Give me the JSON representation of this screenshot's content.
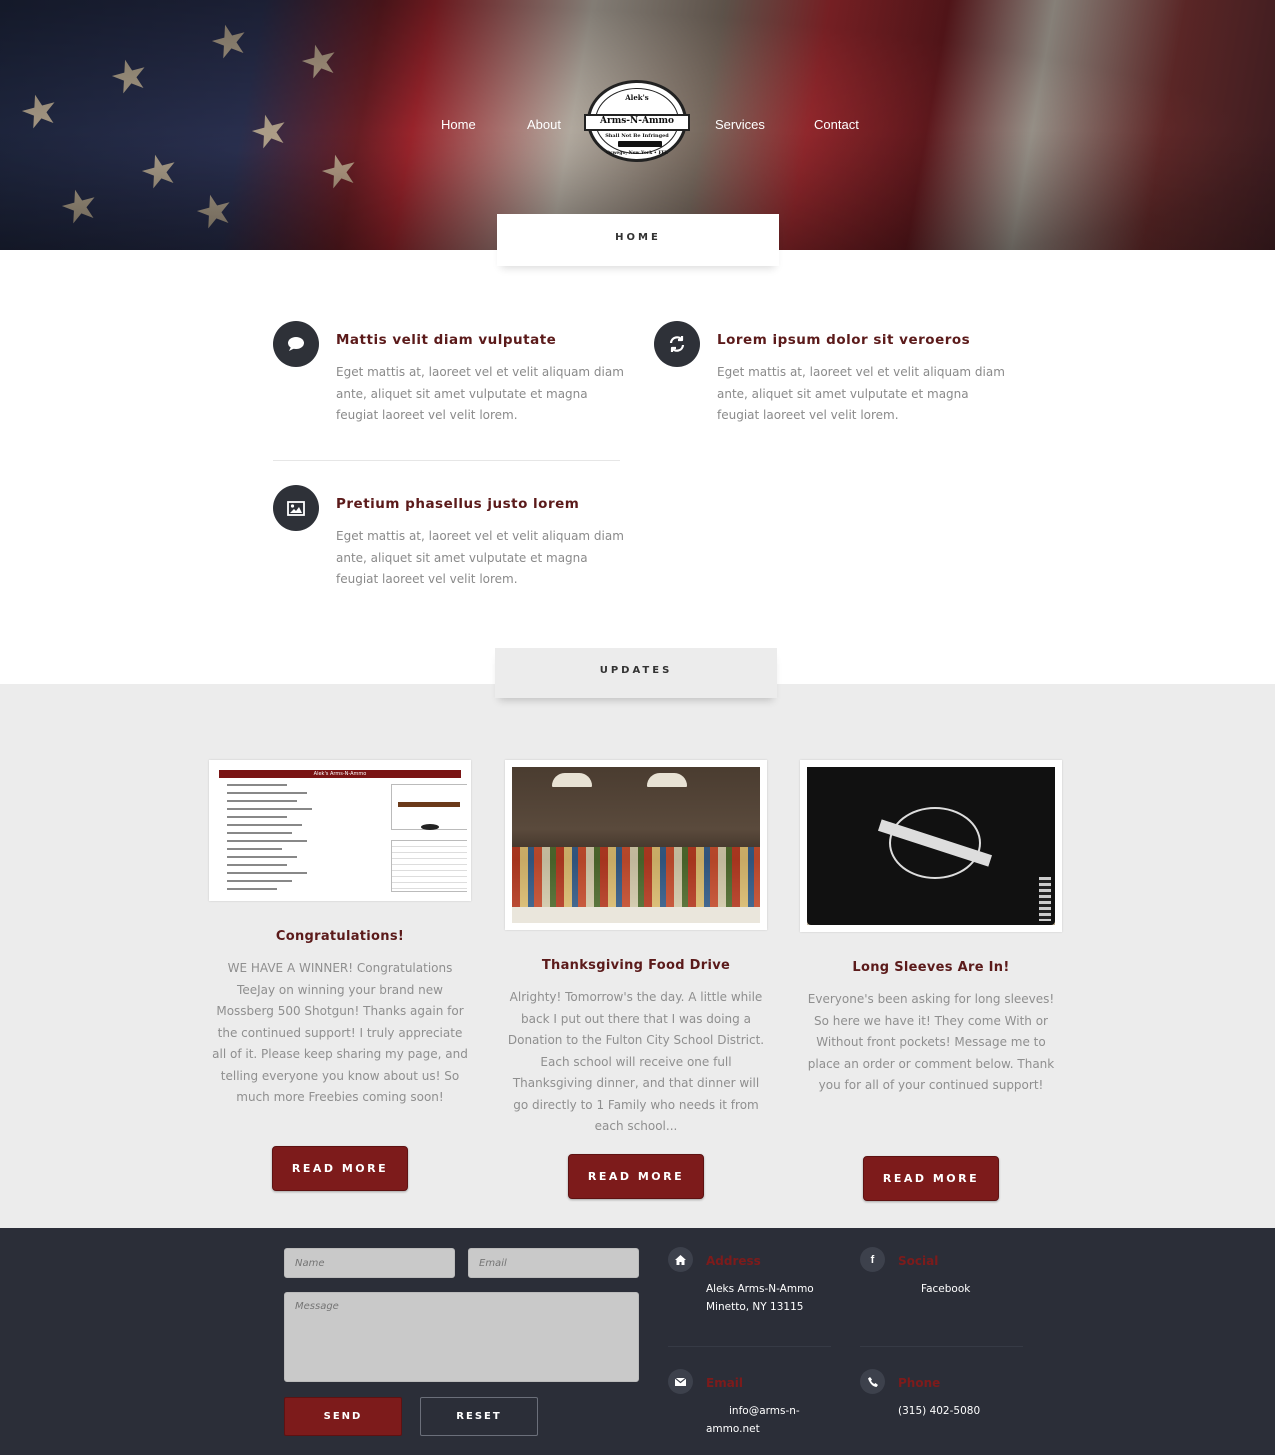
{
  "nav": {
    "items": [
      "Home",
      "About",
      "Services",
      "Contact"
    ]
  },
  "logo": {
    "top_text": "Alek's",
    "name": "Arms-N-Ammo",
    "tagline": "Shall Not Be Infringed",
    "location": "Oswego, New York • FFL"
  },
  "home_tab": "HOME",
  "features": [
    {
      "icon": "speech-bubble-icon",
      "title": "Mattis velit diam vulputate",
      "text": "Eget mattis at, laoreet vel et velit aliquam diam ante, aliquet sit amet vulputate et magna feugiat laoreet vel velit lorem."
    },
    {
      "icon": "refresh-icon",
      "title": "Lorem ipsum dolor sit veroeros",
      "text": "Eget mattis at, laoreet vel et velit aliquam diam ante, aliquet sit amet vulputate et magna feugiat laoreet vel velit lorem."
    },
    {
      "icon": "image-icon",
      "title": "Pretium phasellus justo lorem",
      "text": "Eget mattis at, laoreet vel et velit aliquam diam ante, aliquet sit amet vulputate et magna feugiat laoreet vel velit lorem."
    }
  ],
  "updates_tab": "UPDATES",
  "posts": [
    {
      "title": "Congratulations!",
      "text": "WE HAVE A WINNER! Congratulations TeeJay on winning your brand new Mossberg 500 Shotgun! Thanks again for the continued support! I truly appreciate all of it. Please keep sharing my page, and telling everyone you know about us! So much more Freebies coming soon!",
      "button": "READ MORE",
      "doc_header": "Alek's Arms-N-Ammo"
    },
    {
      "title": "Thanksgiving Food Drive",
      "text": "Alrighty! Tomorrow's the day. A little while back I put out there that I was doing a Donation to the Fulton City School District. Each school will receive one full Thanksgiving dinner, and that dinner will go directly to 1 Family who needs it from each school...",
      "button": "READ MORE"
    },
    {
      "title": "Long Sleeves Are In!",
      "text": "Everyone's been asking for long sleeves! So here we have it! They come With or Without front pockets! Message me to place an order or comment below. Thank you for all of your continued support!",
      "button": "READ MORE"
    }
  ],
  "form": {
    "name_placeholder": "Name",
    "email_placeholder": "Email",
    "message_placeholder": "Message",
    "send": "SEND",
    "reset": "RESET"
  },
  "contact": {
    "address_label": "Address",
    "address_line1": "Aleks Arms-N-Ammo",
    "address_line2": "Minetto, NY 13115",
    "social_label": "Social",
    "social_value": "Facebook",
    "email_label": "Email",
    "email_line1": "info@arms-n-",
    "email_line2": "ammo.net",
    "phone_label": "Phone",
    "phone_value": "(315) 402-5080"
  },
  "colors": {
    "accent": "#7d1b1b",
    "heading": "#5b1a1a",
    "footer_bg": "#2b2e38",
    "icon_bg": "#2e3138"
  }
}
